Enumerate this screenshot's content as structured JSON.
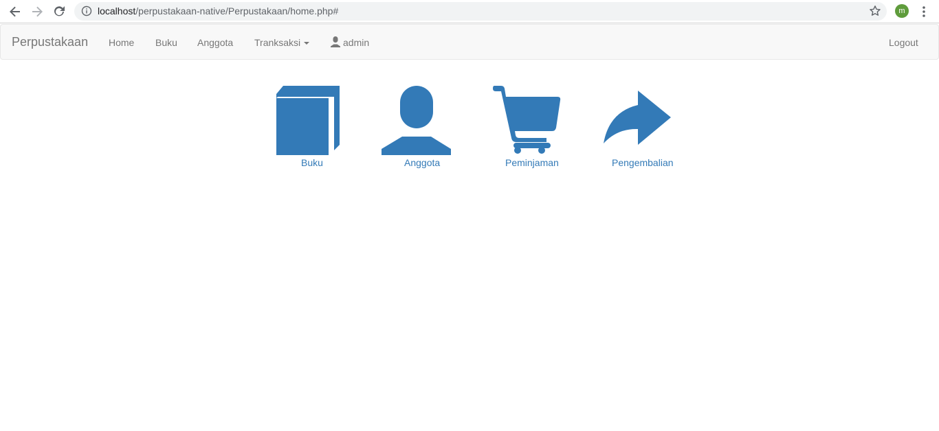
{
  "browser": {
    "url_host": "localhost",
    "url_path": "/perpustakaan-native/Perpustakaan/home.php#",
    "profile_initial": "m",
    "icons": [
      "back-arrow-icon",
      "forward-arrow-icon",
      "reload-icon",
      "info-icon",
      "star-icon",
      "more-vert-icon"
    ]
  },
  "navbar": {
    "brand": "Perpustakaan",
    "home": "Home",
    "buku": "Buku",
    "anggota": "Anggota",
    "transaksi": "Tranksaksi",
    "user": "admin",
    "logout": "Logout"
  },
  "tiles": [
    {
      "label": "Buku",
      "icon": "book-icon"
    },
    {
      "label": "Anggota",
      "icon": "user-icon"
    },
    {
      "label": "Peminjaman",
      "icon": "shopping-cart-icon"
    },
    {
      "label": "Pengembalian",
      "icon": "share-arrow-icon"
    }
  ],
  "colors": {
    "link": "#337ab7",
    "nav_text": "#777777",
    "navbar_bg": "#f8f8f8",
    "avatar_bg": "#5f9c3c"
  }
}
